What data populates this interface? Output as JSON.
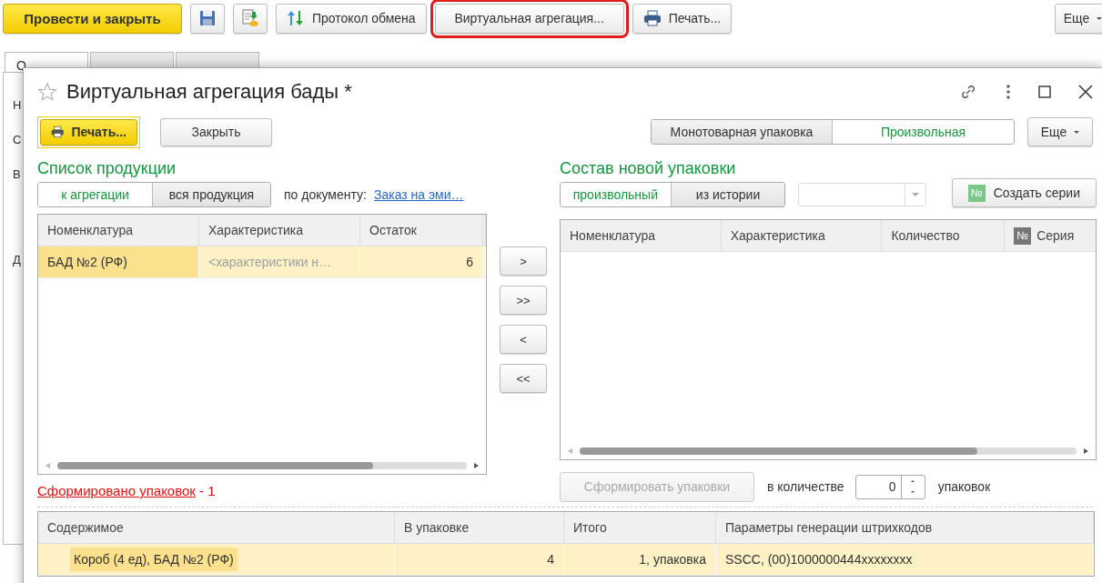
{
  "toolbar": {
    "primary": "Провести и закрыть",
    "exchange_log": "Протокол обмена",
    "virtual_aggregation": {
      "label": "Виртуальная агрегация...",
      "highlighted": true
    },
    "print": "Печать...",
    "more": "Еще"
  },
  "background": {
    "tabs": [
      {
        "label": "О",
        "selected": true
      },
      {
        "selected": false
      },
      {
        "selected": false
      }
    ],
    "side_labels": [
      "Н",
      "С",
      "В",
      "Д"
    ]
  },
  "dialog": {
    "title": "Виртуальная агрегация бады *",
    "starred": false,
    "print": "Печать...",
    "close": "Закрыть",
    "pack_type": [
      {
        "label": "Монотоварная упаковка",
        "selected": false
      },
      {
        "label": "Произвольная",
        "selected": true
      }
    ],
    "more": "Еще",
    "products": {
      "heading": "Список продукции",
      "filter": [
        {
          "label": "к агрегации",
          "selected": true
        },
        {
          "label": "вся продукция",
          "selected": false
        }
      ],
      "doc_label": "по документу:",
      "doc_link": "Заказ на эми…",
      "columns": [
        "Номенклатура",
        "Характеристика",
        "Остаток"
      ],
      "rows": [
        {
          "name": "БАД №2 (РФ)",
          "characteristic": "<характеристики н…",
          "characteristic_placeholder": true,
          "remainder": "6",
          "selected": true
        }
      ]
    },
    "move_buttons": [
      ">",
      ">>",
      "<",
      "<<"
    ],
    "new_package": {
      "heading": "Состав новой упаковки",
      "mode": [
        {
          "label": "произвольный",
          "selected": true
        },
        {
          "label": "из истории",
          "selected": false
        }
      ],
      "create_series": "Создать серии",
      "create_series_icon": "№",
      "columns": [
        {
          "label": "Номенклатура",
          "kind": "text"
        },
        {
          "label": "Характеристика",
          "kind": "text"
        },
        {
          "label": "Количество",
          "kind": "text"
        },
        {
          "label": "Серия",
          "kind": "series",
          "icon": "№"
        }
      ],
      "form_button": {
        "label": "Сформировать упаковки",
        "disabled": true
      },
      "quantity_label": "в количестве",
      "quantity": "0",
      "quantity_unit": "упаковок"
    },
    "status": {
      "link": "Сформировано упаковок",
      "suffix": " - 1"
    },
    "packages": {
      "columns": [
        "Содержимое",
        "В упаковке",
        "Итого",
        "Параметры генерации штрихкодов"
      ],
      "rows": [
        {
          "content": "Короб (4 ед), БАД №2 (РФ)",
          "in_package": "4",
          "total": "1, упаковка",
          "barcode": "SSCC, (00)1000000444xxxxxxxx",
          "selected": true
        }
      ]
    }
  }
}
